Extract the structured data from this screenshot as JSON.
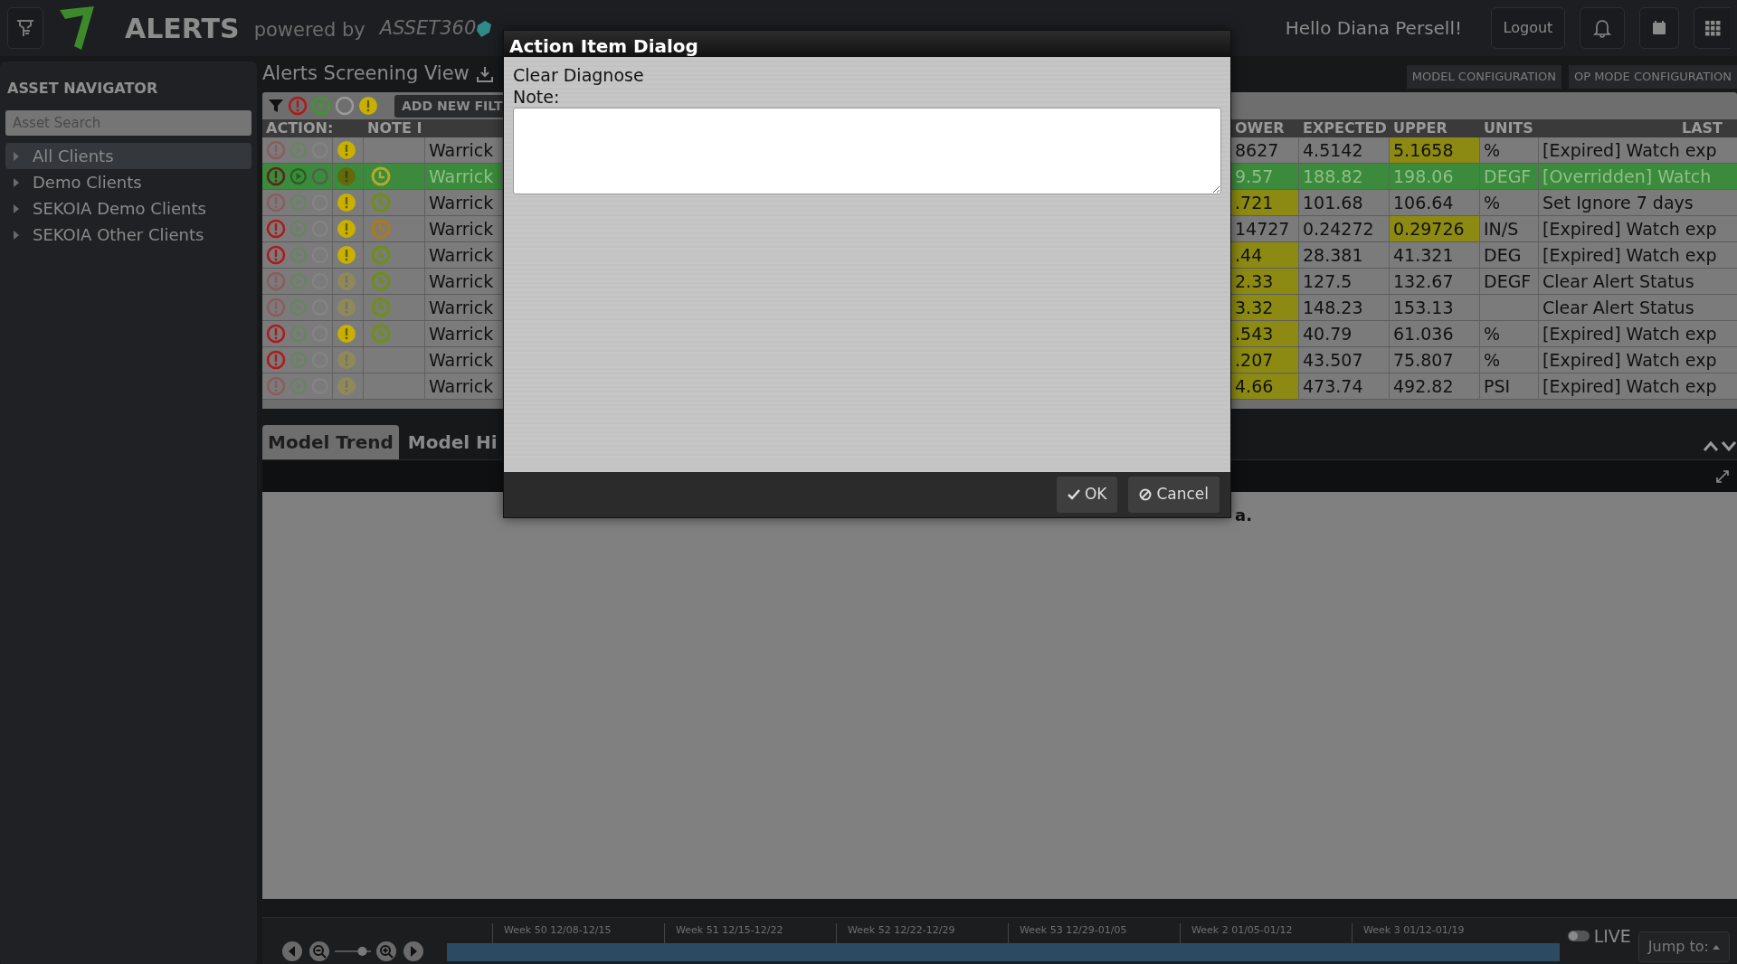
{
  "header": {
    "app_title": "ALERTS",
    "powered_by": "powered by",
    "brand": "ASSET360",
    "greeting": "Hello Diana Persell!",
    "logout": "Logout"
  },
  "sidebar": {
    "title": "ASSET NAVIGATOR",
    "search": {
      "placeholder": "Asset Search"
    },
    "items": [
      {
        "label": "All Clients",
        "selected": true,
        "expanded": false
      },
      {
        "label": "Demo Clients",
        "selected": false,
        "expanded": false
      },
      {
        "label": "SEKOIA Demo Clients",
        "selected": false,
        "expanded": false
      },
      {
        "label": "SEKOIA Other Clients",
        "selected": false,
        "expanded": false
      }
    ]
  },
  "view": {
    "title": "Alerts Screening View",
    "config_buttons": [
      "MODEL CONFIGURATION",
      "OP MODE CONFIGURATION"
    ]
  },
  "filters": {
    "add_filter": "ADD NEW FILT"
  },
  "table": {
    "columns_left": [
      "ACTION:",
      "NOTE I"
    ],
    "columns_right": [
      "OWER",
      "EXPECTED",
      "UPPER",
      "UNITS",
      "LAST"
    ],
    "rows": [
      {
        "selected": false,
        "critical": false,
        "alert_active": true,
        "asset": "Warrick",
        "lower": "8627",
        "lower_flag": false,
        "expected": "4.5142",
        "upper": "5.1658",
        "upper_flag": true,
        "units": "%",
        "last": "[Expired] Watch exp"
      },
      {
        "selected": true,
        "critical": false,
        "alert_active": false,
        "note": {
          "color": "#b8a82a"
        },
        "asset": "Warrick",
        "lower": "9.57",
        "lower_flag": false,
        "expected": "188.82",
        "upper": "198.06",
        "upper_flag": false,
        "units": "DEGF",
        "last": "[Overridden] Watch"
      },
      {
        "selected": false,
        "critical": false,
        "alert_active": true,
        "note": {
          "color": "#6f8f14"
        },
        "asset": "Warrick",
        "lower": ".721",
        "lower_flag": true,
        "expected": "101.68",
        "upper": "106.64",
        "upper_flag": false,
        "units": "%",
        "last": "Set Ignore 7 days"
      },
      {
        "selected": false,
        "critical": true,
        "alert_active": true,
        "note": {
          "color": "#b07a10"
        },
        "asset": "Warrick",
        "lower": "14727",
        "lower_flag": false,
        "expected": "0.24272",
        "upper": "0.29726",
        "upper_flag": true,
        "units": "IN/S",
        "last": "[Expired] Watch exp"
      },
      {
        "selected": false,
        "critical": true,
        "alert_active": true,
        "note": {
          "color": "#6f8f14"
        },
        "asset": "Warrick",
        "lower": ".44",
        "lower_flag": true,
        "expected": "28.381",
        "upper": "41.321",
        "upper_flag": false,
        "units": "DEG",
        "last": "[Expired] Watch exp"
      },
      {
        "selected": false,
        "critical": false,
        "alert_active": false,
        "note": {
          "color": "#6f8f14"
        },
        "asset": "Warrick",
        "lower": "2.33",
        "lower_flag": true,
        "expected": "127.5",
        "upper": "132.67",
        "upper_flag": false,
        "units": "DEGF",
        "last": "Clear Alert Status"
      },
      {
        "selected": false,
        "critical": false,
        "alert_active": false,
        "note": {
          "color": "#6f8f14"
        },
        "asset": "Warrick",
        "lower": "3.32",
        "lower_flag": true,
        "expected": "148.23",
        "upper": "153.13",
        "upper_flag": false,
        "last": "Clear Alert Status"
      },
      {
        "selected": false,
        "critical": true,
        "alert_active": true,
        "note": {
          "color": "#6f8f14"
        },
        "asset": "Warrick",
        "lower": ".543",
        "lower_flag": true,
        "expected": "40.79",
        "upper": "61.036",
        "upper_flag": false,
        "units": "%",
        "last": "[Expired] Watch exp"
      },
      {
        "selected": false,
        "critical": true,
        "alert_active": false,
        "asset": "Warrick",
        "lower": ".207",
        "lower_flag": true,
        "expected": "43.507",
        "upper": "75.807",
        "upper_flag": false,
        "units": "%",
        "last": "[Expired] Watch exp"
      },
      {
        "selected": false,
        "critical": false,
        "alert_active": false,
        "asset": "Warrick",
        "lower": "4.66",
        "lower_flag": true,
        "expected": "473.74",
        "upper": "492.82",
        "upper_flag": false,
        "units": "PSI",
        "last": "[Expired] Watch exp"
      }
    ]
  },
  "bottom_tabs": [
    {
      "label": "Model Trend",
      "selected": true
    },
    {
      "label": "Model Hi",
      "selected": false
    }
  ],
  "chart_message": "a.",
  "timeline": {
    "zoom": {
      "level": 0.85
    },
    "ticks": [
      "Week 50 12/08-12/15",
      "Week 51 12/15-12/22",
      "Week 52 12/22-12/29",
      "Week 53 12/29-01/05",
      "Week 2 01/05-01/12",
      "Week 3 01/12-01/19"
    ],
    "live": {
      "label": "LIVE",
      "on": false
    },
    "jump_to": "Jump to:"
  },
  "dialog": {
    "title": "Action Item Dialog",
    "action": "Clear Diagnose",
    "note_label": "Note:",
    "buttons": [
      {
        "label": "OK",
        "kind": "ok"
      },
      {
        "label": "Cancel",
        "kind": "cancel"
      }
    ]
  }
}
